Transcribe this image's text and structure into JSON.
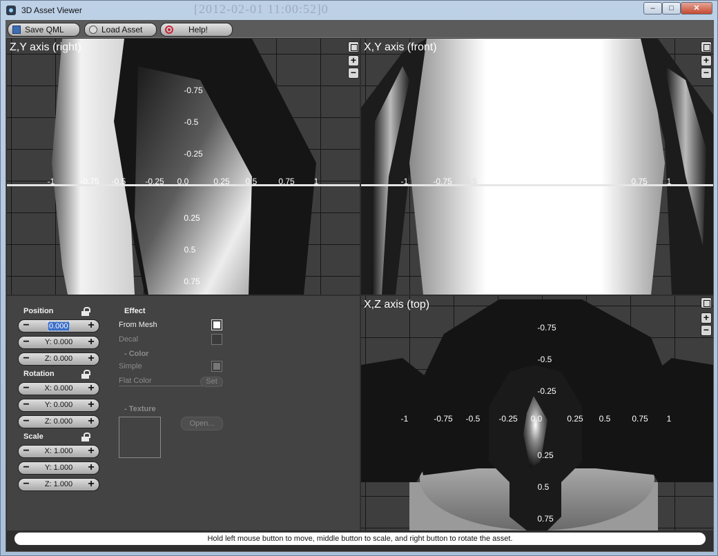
{
  "window": {
    "title": "3D Asset Viewer",
    "ghost_text": "[2012-02-01 11:00:52]0"
  },
  "toolbar": {
    "save_label": "Save QML",
    "load_label": "Load Asset",
    "help_label": "Help!"
  },
  "viewports": {
    "right": {
      "title": "Z,Y axis (right)",
      "h_ticks": [
        "-1",
        "-0.75",
        "-0.5",
        "-0.25",
        "0.0",
        "0.25",
        "0.5",
        "0.75",
        "1"
      ],
      "v_ticks_top": [
        "-0.75",
        "-0.5",
        "-0.25"
      ],
      "v_ticks_bottom": [
        "0.25",
        "0.5",
        "0.75"
      ]
    },
    "front": {
      "title": "X,Y axis (front)",
      "h_ticks": [
        "-1",
        "-0.75",
        "-0.5",
        "0.75",
        "1"
      ]
    },
    "top": {
      "title": "X,Z axis (top)",
      "h_ticks": [
        "-1",
        "-0.75",
        "-0.5",
        "-0.25",
        "0.0",
        "0.25",
        "0.5",
        "0.75",
        "1"
      ],
      "v_ticks_top": [
        "-0.75",
        "-0.5",
        "-0.25"
      ],
      "v_ticks_bottom": [
        "0.25",
        "0.5",
        "0.75"
      ]
    },
    "zoom_in_glyph": "+",
    "zoom_out_glyph": "−"
  },
  "panel": {
    "position": {
      "label": "Position",
      "x": "0.000",
      "y": "Y: 0.000",
      "z": "Z: 0.000"
    },
    "rotation": {
      "label": "Rotation",
      "x": "X: 0.000",
      "y": "Y: 0.000",
      "z": "Z: 0.000"
    },
    "scale": {
      "label": "Scale",
      "x": "X: 1.000",
      "y": "Y: 1.000",
      "z": "Z: 1.000"
    },
    "spin_minus": "−",
    "spin_plus": "+",
    "effect": {
      "label": "Effect",
      "from_mesh": "From Mesh",
      "from_mesh_checked": true,
      "decal": "Decal",
      "decal_checked": false,
      "color_header": "- Color",
      "simple": "Simple",
      "flat_color": "Flat Color",
      "set_button": "Set",
      "texture_header": "- Texture",
      "open_button": "Open..."
    }
  },
  "status": {
    "text": "Hold left mouse button to move, middle button to scale, and right button to rotate the asset."
  },
  "colors": {
    "viewport_bg": "#3e3e3e",
    "panel_bg": "#434343",
    "selection": "#3a6ec6"
  }
}
